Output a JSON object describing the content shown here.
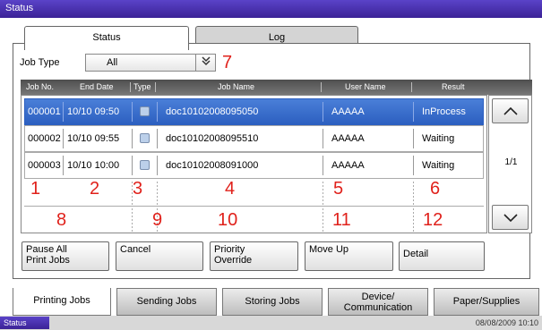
{
  "window": {
    "title": "Status"
  },
  "top_tabs": [
    {
      "label": "Status",
      "active": true
    },
    {
      "label": "Log",
      "active": false
    }
  ],
  "job_type": {
    "label": "Job Type",
    "value": "All"
  },
  "columns": [
    "Job No.",
    "End Date",
    "Type",
    "Job Name",
    "User Name",
    "Result"
  ],
  "rows": [
    {
      "job_no": "000001",
      "end_date": "10/10 09:50",
      "job_name": "doc10102008095050",
      "user_name": "AAAAA",
      "result": "InProcess",
      "selected": true
    },
    {
      "job_no": "000002",
      "end_date": "10/10 09:55",
      "job_name": "doc10102008095510",
      "user_name": "AAAAA",
      "result": "Waiting",
      "selected": false
    },
    {
      "job_no": "000003",
      "end_date": "10/10 10:00",
      "job_name": "doc10102008091000",
      "user_name": "AAAAA",
      "result": "Waiting",
      "selected": false
    }
  ],
  "pager": {
    "indicator": "1/1"
  },
  "callouts": {
    "c1": "1",
    "c2": "2",
    "c3": "3",
    "c4": "4",
    "c5": "5",
    "c6": "6",
    "c7": "7",
    "c8": "8",
    "c9": "9",
    "c10": "10",
    "c11": "11",
    "c12": "12"
  },
  "actions": {
    "pause_line1": "Pause All",
    "pause_line2": "Print Jobs",
    "cancel": "Cancel",
    "priority_line1": "Priority",
    "priority_line2": "Override",
    "move_up": "Move Up",
    "detail": "Detail"
  },
  "bottom_tabs": [
    {
      "label": "Printing Jobs",
      "active": true
    },
    {
      "label": "Sending Jobs",
      "active": false
    },
    {
      "label": "Storing Jobs",
      "active": false
    },
    {
      "label_line1": "Device/",
      "label_line2": "Communication",
      "active": false
    },
    {
      "label": "Paper/Supplies",
      "active": false
    }
  ],
  "status_bar": {
    "label": "Status",
    "datetime": "08/08/2009   10:10"
  },
  "colors": {
    "accent": "#4a2fb0",
    "selected_row": "#2c5fc0",
    "callout": "#e0211b"
  },
  "icons": {
    "type_icon": "print-job-icon",
    "scroll_up": "chevron-up-icon",
    "scroll_down": "chevron-down-icon",
    "dropdown": "double-chevron-down-icon"
  }
}
